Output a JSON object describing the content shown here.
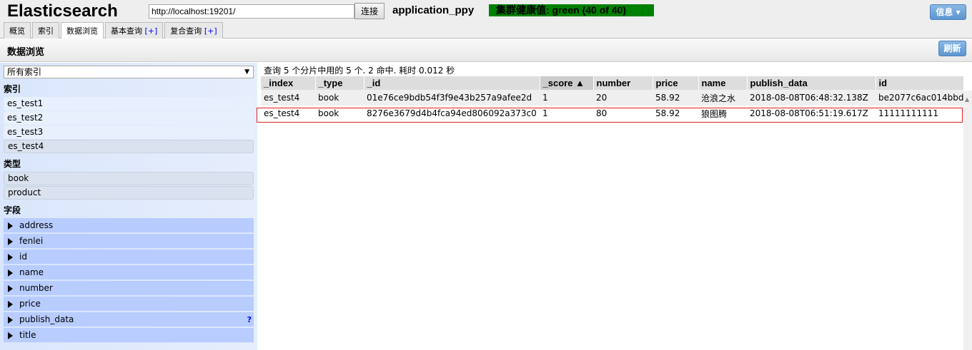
{
  "header": {
    "logo": "Elasticsearch",
    "url": "http://localhost:19201/",
    "connect": "连接",
    "cluster": "application_ppy",
    "health": "集群健康值: green (40 of 40)",
    "info": "信息 ▾"
  },
  "tabs": [
    {
      "label": "概览"
    },
    {
      "label": "索引"
    },
    {
      "label": "数据浏览"
    },
    {
      "label": "基本查询",
      "plus": "[+]"
    },
    {
      "label": "复合查询",
      "plus": "[+]"
    }
  ],
  "page": {
    "title": "数据浏览",
    "refresh": "刷新"
  },
  "sidebar": {
    "select": "所有索引",
    "indices_label": "索引",
    "indices": [
      "es_test1",
      "es_test2",
      "es_test3",
      "es_test4"
    ],
    "types_label": "类型",
    "types": [
      "book",
      "product"
    ],
    "fields_label": "字段",
    "fields": [
      "address",
      "fenlei",
      "id",
      "name",
      "number",
      "price",
      "publish_data",
      "title"
    ],
    "help": "?"
  },
  "results": {
    "summary": "查询 5 个分片中用的 5 个. 2 命中. 耗时 0.012 秒",
    "columns": [
      "_index",
      "_type",
      "_id",
      "_score ▲",
      "number",
      "price",
      "name",
      "publish_data",
      "id"
    ],
    "rows": [
      [
        "es_test4",
        "book",
        "01e76ce9bdb54f3f9e43b257a9afee2d",
        "1",
        "20",
        "58.92",
        "沧浪之水",
        "2018-08-08T06:48:32.138Z",
        "be2077c6ac014bbd"
      ],
      [
        "es_test4",
        "book",
        "8276e3679d4b4fca94ed806092a373c0",
        "1",
        "80",
        "58.92",
        "狼图腾",
        "2018-08-08T06:51:19.617Z",
        "11111111111"
      ]
    ]
  }
}
